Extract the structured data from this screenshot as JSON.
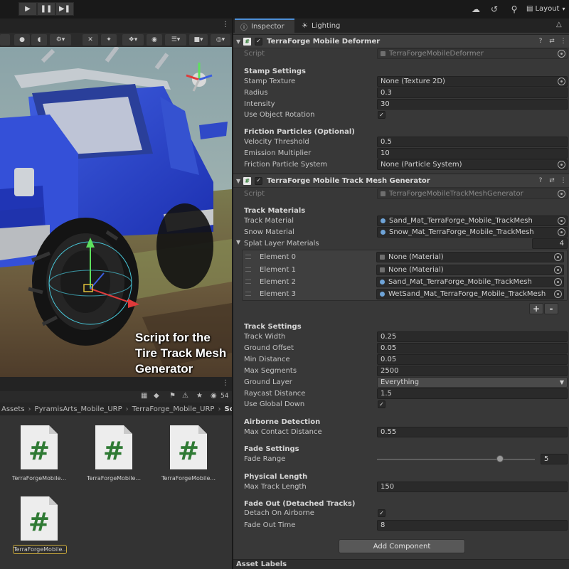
{
  "toolbar": {
    "play_icon": "play-icon",
    "pause_icon": "pause-icon",
    "step_icon": "step-icon",
    "layout_label": "Layout"
  },
  "scene": {
    "caption_lines": [
      "Script for the",
      "Tire Track Mesh",
      "Generator"
    ]
  },
  "project": {
    "count": "54",
    "breadcrumb": [
      "Assets",
      "PyramisArts_Mobile_URP",
      "TerraForge_Mobile_URP",
      "Scripts"
    ],
    "assets": [
      {
        "label": "TerraForgeMobile..."
      },
      {
        "label": "TerraForgeMobile..."
      },
      {
        "label": "TerraForgeMobile..."
      },
      {
        "label": "TerraForgeMobile..."
      }
    ]
  },
  "inspector": {
    "tabs": [
      {
        "label": "Inspector"
      },
      {
        "label": "Lighting"
      }
    ],
    "deformer": {
      "title": "TerraForge Mobile Deformer",
      "script_label": "Script",
      "script_value": "TerraForgeMobileDeformer",
      "stamp_header": "Stamp Settings",
      "stamp_texture_label": "Stamp Texture",
      "stamp_texture_value": "None (Texture 2D)",
      "radius_label": "Radius",
      "radius_value": "0.3",
      "intensity_label": "Intensity",
      "intensity_value": "30",
      "use_rotation_label": "Use Object Rotation",
      "friction_header": "Friction Particles (Optional)",
      "velocity_label": "Velocity Threshold",
      "velocity_value": "0.5",
      "emission_label": "Emission Multiplier",
      "emission_value": "10",
      "friction_system_label": "Friction Particle System",
      "friction_system_value": "None (Particle System)"
    },
    "generator": {
      "title": "TerraForge Mobile Track Mesh Generator",
      "script_label": "Script",
      "script_value": "TerraForgeMobileTrackMeshGenerator",
      "materials_header": "Track Materials",
      "track_material_label": "Track Material",
      "track_material_value": "Sand_Mat_TerraForge_Mobile_TrackMesh",
      "snow_material_label": "Snow Material",
      "snow_material_value": "Snow_Mat_TerraForge_Mobile_TrackMesh",
      "splat_label": "Splat Layer Materials",
      "splat_count": "4",
      "elements": [
        {
          "label": "Element 0",
          "value": "None (Material)"
        },
        {
          "label": "Element 1",
          "value": "None (Material)"
        },
        {
          "label": "Element 2",
          "value": "Sand_Mat_TerraForge_Mobile_TrackMesh"
        },
        {
          "label": "Element 3",
          "value": "WetSand_Mat_TerraForge_Mobile_TrackMesh"
        }
      ],
      "add_label": "+",
      "remove_label": "-",
      "track_settings_header": "Track Settings",
      "track_width_label": "Track Width",
      "track_width_value": "0.25",
      "ground_offset_label": "Ground Offset",
      "ground_offset_value": "0.05",
      "min_distance_label": "Min Distance",
      "min_distance_value": "0.05",
      "max_segments_label": "Max Segments",
      "max_segments_value": "2500",
      "ground_layer_label": "Ground Layer",
      "ground_layer_value": "Everything",
      "raycast_label": "Raycast Distance",
      "raycast_value": "1.5",
      "global_down_label": "Use Global Down",
      "airborne_header": "Airborne Detection",
      "max_contact_label": "Max Contact Distance",
      "max_contact_value": "0.55",
      "fade_header": "Fade Settings",
      "fade_range_label": "Fade Range",
      "fade_range_value": "5",
      "fade_range_fraction": 0.78,
      "physical_header": "Physical Length",
      "max_track_label": "Max Track Length",
      "max_track_value": "150",
      "fade_out_header": "Fade Out (Detached Tracks)",
      "detach_label": "Detach On Airborne",
      "fade_time_label": "Fade Out Time",
      "fade_time_value": "8"
    },
    "add_component_label": "Add Component",
    "asset_labels_label": "Asset Labels"
  }
}
